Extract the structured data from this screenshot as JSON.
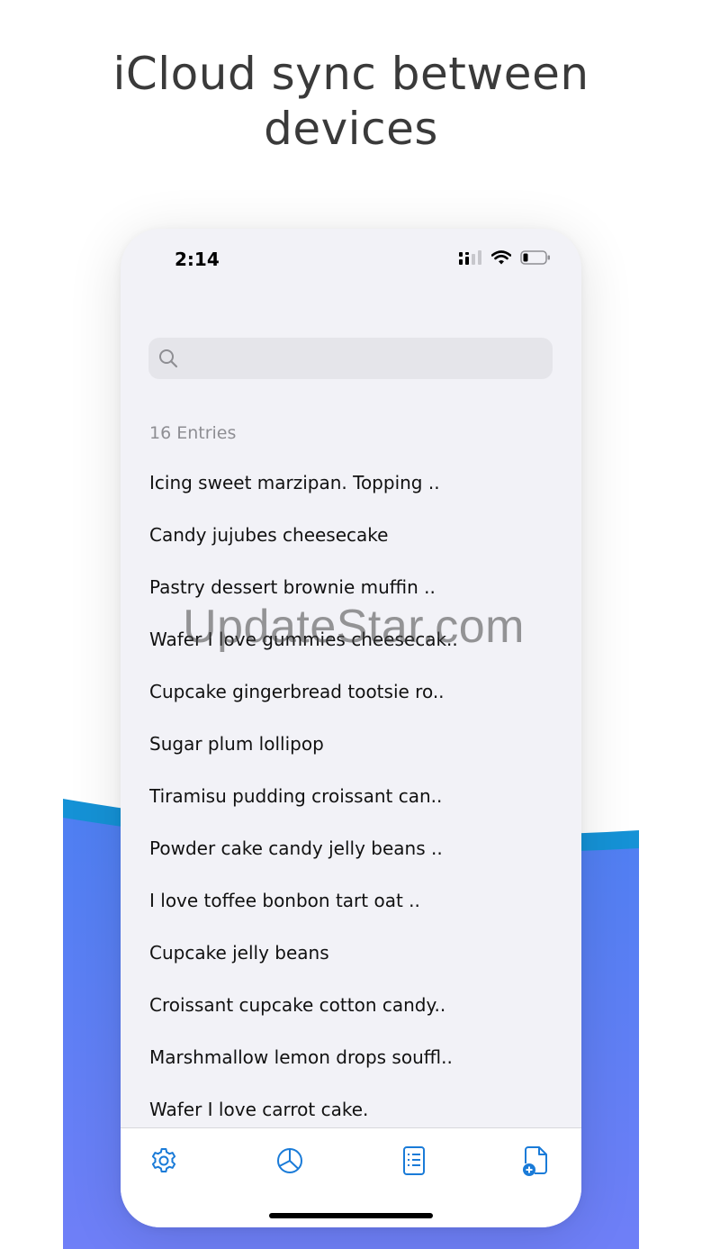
{
  "headline": {
    "line1": "iCloud sync between",
    "line2": "devices"
  },
  "status_bar": {
    "time": "2:14",
    "icons": [
      "signal-icon",
      "wifi-icon",
      "battery-icon"
    ]
  },
  "search": {
    "placeholder": "",
    "value": ""
  },
  "entries": {
    "count_label": "16 Entries",
    "items": [
      "Icing sweet marzipan. Topping ..",
      "Candy jujubes cheesecake",
      "Pastry dessert brownie muffin ..",
      "Wafer I love gummies cheesecak..",
      "Cupcake gingerbread tootsie ro..",
      "Sugar plum lollipop",
      "Tiramisu pudding croissant can..",
      "Powder cake candy jelly beans ..",
      "I love toffee bonbon tart oat ..",
      "Cupcake jelly beans",
      "Croissant cupcake cotton candy..",
      "Marshmallow lemon drops souffl..",
      "Wafer I love carrot cake."
    ]
  },
  "tabbar": {
    "tabs": [
      "gear-icon",
      "pie-chart-icon",
      "list-document-icon",
      "new-document-icon"
    ]
  },
  "watermark": "UpdateStar.com",
  "colors": {
    "accent": "#1a7bd8",
    "background_wave_top": "#1592d6",
    "background_wave_bottom": "#6f7ff7",
    "phone_bg": "#f2f2f7"
  }
}
